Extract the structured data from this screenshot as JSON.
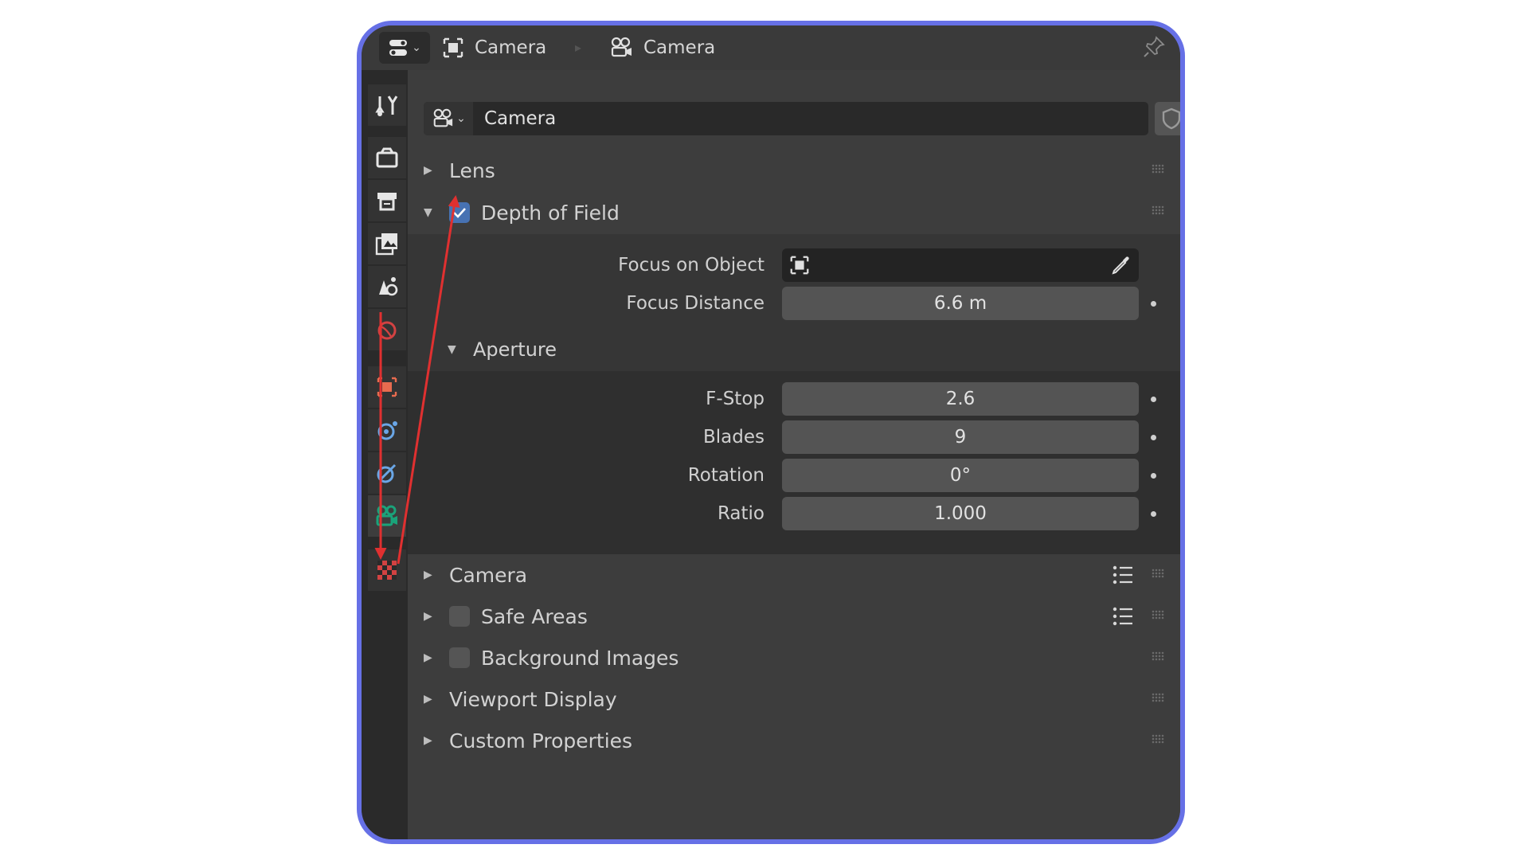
{
  "header": {
    "crumb1": "Camera",
    "crumb2": "Camera"
  },
  "datablock": {
    "name": "Camera"
  },
  "panels": {
    "lens": "Lens",
    "dof": "Depth of Field",
    "camera": "Camera",
    "safe_areas": "Safe Areas",
    "background_images": "Background Images",
    "viewport_display": "Viewport Display",
    "custom_properties": "Custom Properties"
  },
  "dof": {
    "enabled": true,
    "focus_object_label": "Focus on Object",
    "focus_distance_label": "Focus Distance",
    "focus_distance_value": "6.6 m"
  },
  "aperture": {
    "title": "Aperture",
    "fstop_label": "F-Stop",
    "fstop_value": "2.6",
    "blades_label": "Blades",
    "blades_value": "9",
    "rotation_label": "Rotation",
    "rotation_value": "0°",
    "ratio_label": "Ratio",
    "ratio_value": "1.000"
  },
  "colors": {
    "accent": "#4772b3",
    "frame": "#6670e6",
    "annotation": "#e03030",
    "active_tab": "#1aa37a"
  }
}
